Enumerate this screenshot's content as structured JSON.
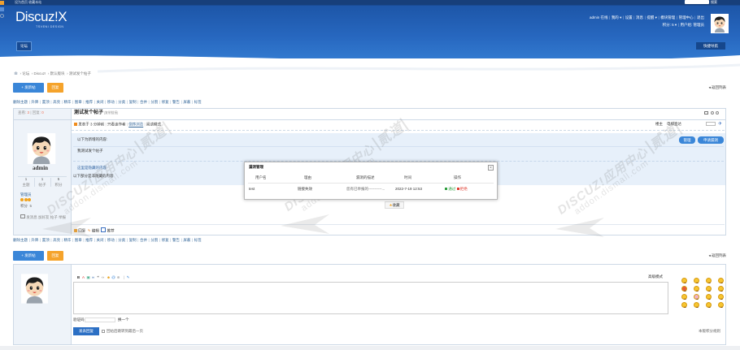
{
  "topbar": {
    "left": "设为首页 收藏本站",
    "search_btn": "搜索"
  },
  "header": {
    "logo": "Discuz!X",
    "logo_sub": "TSVENI DESIGN",
    "user_links": [
      "admin 在线",
      "我的 ▾",
      "设置",
      "消息",
      "提醒 ▾",
      "模块管理",
      "管理中心",
      "退出"
    ],
    "user_meta": [
      "积分: 5 ▾",
      "用户组: 管理员"
    ]
  },
  "nav": {
    "forum": "论坛",
    "quick": "快捷导航"
  },
  "breadcrumb": [
    "论坛",
    "Discuz!",
    "默认版块",
    "测试发个帖子"
  ],
  "actions": {
    "new_thread": "+ 发新帖",
    "reply": "回复",
    "back": "◂ 返回列表"
  },
  "mod_tools": [
    "删除主题",
    "升降",
    "置顶",
    "高亮",
    "精华",
    "图章",
    "推荐",
    "关闭",
    "移动",
    "分类",
    "复制",
    "合并",
    "分割",
    "修复",
    "警告",
    "屏蔽",
    "标签"
  ],
  "thread": {
    "views_label": "查看:",
    "views": "3",
    "replies_label": "回复:",
    "replies": "0",
    "title": "测试发个帖子",
    "copy_link": "[复制链接]"
  },
  "post": {
    "posted": "发表于 3 分钟前",
    "links": [
      "只看该作者",
      "倒序浏览",
      "阅读模式"
    ],
    "floor": "楼主",
    "jump": "电梯直达",
    "new_content_label": "以下为新增的内容:",
    "btn_manage": "管理",
    "btn_apply": "申请漏洞",
    "body": "我测试发个帖子",
    "hidden": "这里是隐藏的内容",
    "visible": "以下部分是非隐藏的内容",
    "footer": {
      "reply": "回复",
      "edit": "编辑",
      "recommend": "推荐"
    },
    "fav": "收藏"
  },
  "author": {
    "name": "admin",
    "stats": [
      {
        "value": "1",
        "label": "主题"
      },
      {
        "value": "1",
        "label": "帖子"
      },
      {
        "value": "5",
        "label": "积分"
      }
    ],
    "group": "管理员",
    "credits_label": "积分",
    "credits": "5",
    "links": "发消息 加好友 帖子 举报"
  },
  "modal": {
    "title": "漏洞管理",
    "close": "×",
    "headers": [
      "用户名",
      "理由",
      "漏洞的描述",
      "时间",
      "操作"
    ],
    "rows": [
      {
        "user": "test",
        "reason": "链接失效",
        "desc": "您有已举报的-----------...",
        "time": "2022-7-19 12:53",
        "approve": "通过",
        "reject": "拒绝"
      }
    ]
  },
  "reply": {
    "advanced": "高级模式",
    "captcha_label": "验证码",
    "captcha_change": "换一个",
    "submit": "发表回复",
    "jump_last": "回帖后跳转到最后一页",
    "rules": "本版积分规则"
  },
  "watermark": {
    "line1": "DISCUZ!应用中心",
    "line2": "addon.dismall.com",
    "brand": "贰道"
  },
  "colors": {
    "header": "#2767bf",
    "primary": "#3a86d8",
    "reply": "#f5a32b",
    "link": "#336699",
    "approve": "#2e9e3e",
    "reject": "#e03b2e"
  }
}
